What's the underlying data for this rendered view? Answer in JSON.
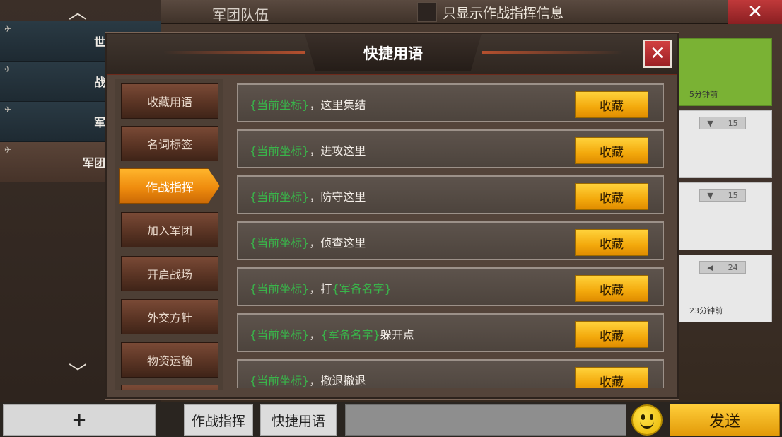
{
  "top_bar": {
    "title": "军团队伍",
    "filter_label": "只显示作战指挥信息",
    "close_icon": "✕"
  },
  "sidebar": {
    "up_arrow": "︿",
    "down_arrow": "﹀",
    "channels": [
      {
        "label": "世界",
        "pin": "✈"
      },
      {
        "label": "战场",
        "pin": "✈"
      },
      {
        "label": "军团",
        "pin": "✈"
      },
      {
        "label": "军团队伍",
        "pin": "✈"
      }
    ],
    "add_label": "+"
  },
  "side_panels": [
    {
      "time": "5分钟前"
    },
    {
      "badge_icon": "▼",
      "badge_value": "15"
    },
    {
      "badge_icon": "▼",
      "badge_value": "15"
    },
    {
      "badge_icon": "◀",
      "badge_value": "24",
      "time": "23分钟前"
    }
  ],
  "modal": {
    "title": "快捷用语",
    "close_icon": "✕",
    "categories": [
      {
        "label": "收藏用语"
      },
      {
        "label": "名词标签"
      },
      {
        "label": "作战指挥",
        "active": true
      },
      {
        "label": "加入军团"
      },
      {
        "label": "开启战场"
      },
      {
        "label": "外交方针"
      },
      {
        "label": "物资运输"
      }
    ],
    "phrases": [
      {
        "tag": "{当前坐标}",
        "text": "，这里集结",
        "extra_tag": "",
        "tail": "",
        "button": "收藏"
      },
      {
        "tag": "{当前坐标}",
        "text": "，进攻这里",
        "extra_tag": "",
        "tail": "",
        "button": "收藏"
      },
      {
        "tag": "{当前坐标}",
        "text": "，防守这里",
        "extra_tag": "",
        "tail": "",
        "button": "收藏"
      },
      {
        "tag": "{当前坐标}",
        "text": "，侦查这里",
        "extra_tag": "",
        "tail": "",
        "button": "收藏"
      },
      {
        "tag": "{当前坐标}",
        "text": "，打",
        "extra_tag": "{军备名字}",
        "tail": "",
        "button": "收藏"
      },
      {
        "tag": "{当前坐标}",
        "text": "，",
        "extra_tag": "{军备名字}",
        "tail": "躲开点",
        "button": "收藏"
      },
      {
        "tag": "{当前坐标}",
        "text": "，撤退撤退",
        "extra_tag": "",
        "tail": "",
        "button": "收藏"
      }
    ]
  },
  "bottom_bar": {
    "tab_command": "作战指挥",
    "tab_quick": "快捷用语",
    "input_value": "",
    "emoji_icon": "smiley-icon",
    "send_label": "发送"
  },
  "colors": {
    "accent_orange": "#ef8c0e",
    "tag_green": "#39b54a",
    "button_yellow": "#f3a90c",
    "close_red": "#c0393a"
  }
}
